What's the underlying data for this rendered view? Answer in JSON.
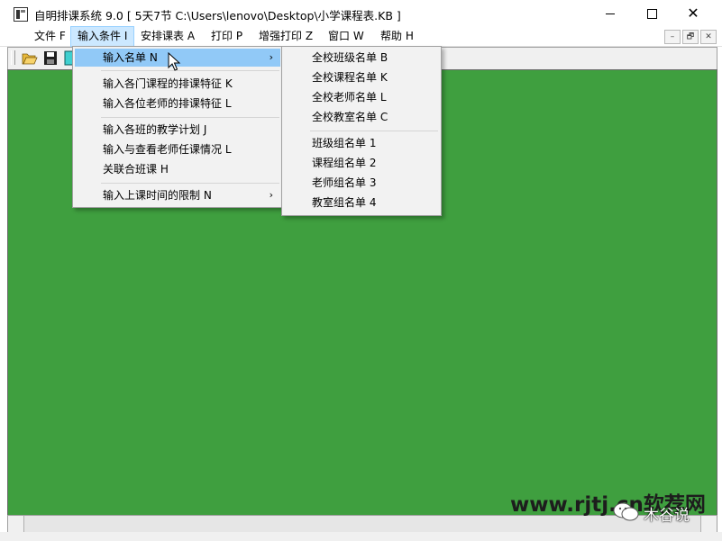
{
  "window": {
    "title": "自明排课系统 9.0 [ 5天7节 C:\\Users\\lenovo\\Desktop\\小学课程表.KB ]",
    "close_glyph": "✕"
  },
  "menubar": {
    "items": [
      {
        "label": "文件 F"
      },
      {
        "label": "输入条件 I"
      },
      {
        "label": "安排课表 A"
      },
      {
        "label": "打印 P"
      },
      {
        "label": "增强打印 Z"
      },
      {
        "label": "窗口 W"
      },
      {
        "label": "帮助 H"
      }
    ]
  },
  "mdi_controls": {
    "minimize": "–",
    "restore": "🗗",
    "close": "✕"
  },
  "input_menu": {
    "items": [
      {
        "label": "输入名单 N",
        "submenu_arrow": "›"
      },
      {
        "label": "输入各门课程的排课特征 K"
      },
      {
        "label": "输入各位老师的排课特征 L"
      },
      {
        "label": "输入各班的教学计划 J"
      },
      {
        "label": "输入与查看老师任课情况 L"
      },
      {
        "label": "关联合班课 H"
      },
      {
        "label": "输入上课时间的限制 N",
        "submenu_arrow": "›"
      }
    ]
  },
  "names_submenu": {
    "items": [
      {
        "label": "全校班级名单 B"
      },
      {
        "label": "全校课程名单 K"
      },
      {
        "label": "全校老师名单 L"
      },
      {
        "label": "全校教室名单 C"
      },
      {
        "label": "班级组名单 1"
      },
      {
        "label": "课程组名单 2"
      },
      {
        "label": "老师组名单 3"
      },
      {
        "label": "教室组名单 4"
      }
    ]
  },
  "watermark": {
    "site": "www.rjtj.cn软荐网",
    "account": "木谷说"
  },
  "colors": {
    "workspace": "#3f9f3f",
    "menu_highlight": "#91c9f7",
    "menubar_active": "#cce8ff"
  }
}
